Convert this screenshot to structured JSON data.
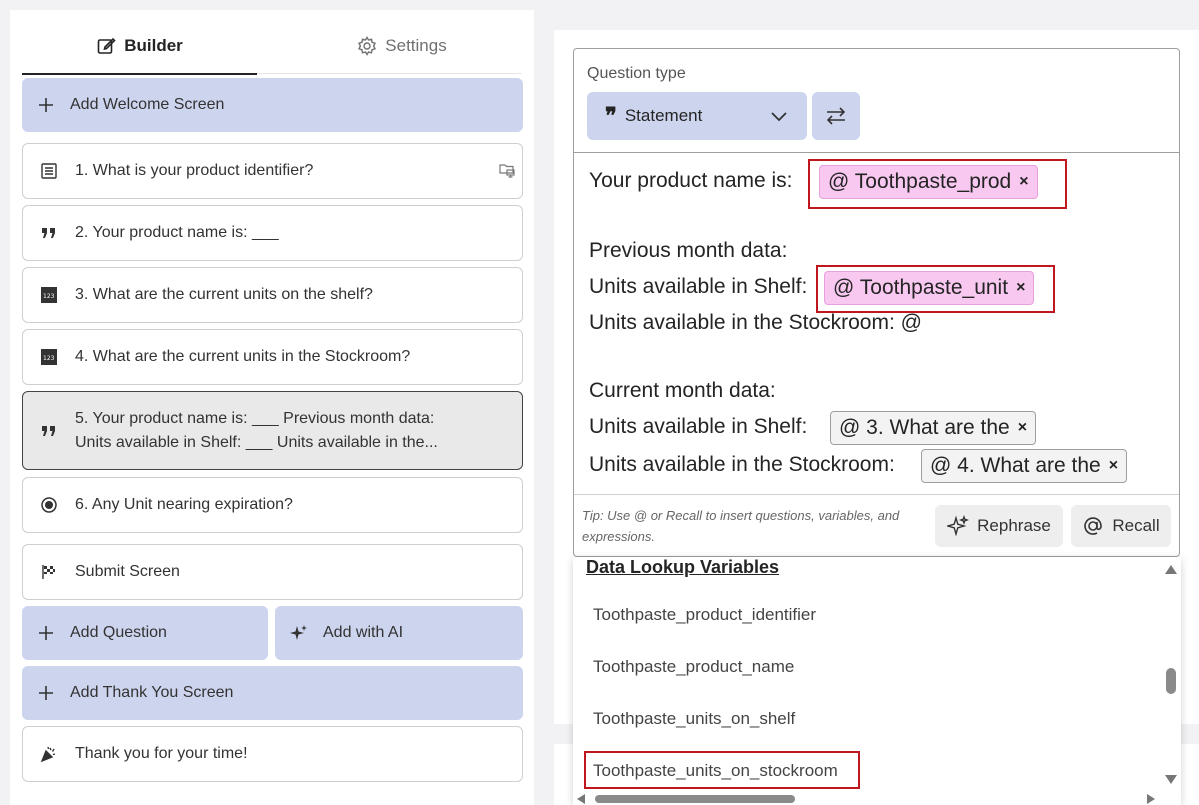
{
  "tabs": {
    "builder": "Builder",
    "settings": "Settings"
  },
  "sidebar": {
    "add_welcome": "Add Welcome Screen",
    "items": [
      {
        "label": "1. What is your product identifier?"
      },
      {
        "label": "2. Your product name is: ___"
      },
      {
        "label": "3. What are the current units on the shelf?"
      },
      {
        "label": "4. What are the current units in the Stockroom?"
      },
      {
        "label_line1": "5. Your product name is:  ___   Previous month data:",
        "label_line2": "Units available in Shelf: ___   Units available in the..."
      },
      {
        "label": "6. Any Unit nearing expiration?"
      }
    ],
    "submit": "Submit Screen",
    "add_question": "Add Question",
    "add_ai": "Add with AI",
    "add_thank_you": "Add Thank You Screen",
    "thank_you": "Thank you for your time!"
  },
  "editor": {
    "question_type_label": "Question type",
    "question_type_value": "Statement",
    "lines": {
      "l1": "Your product name is:",
      "l2": "Previous month data:",
      "l3": "Units available in Shelf:",
      "l4": "Units available in the Stockroom:  @",
      "l5": "Current month data:",
      "l6": "Units available in Shelf:",
      "l7": "Units available in the Stockroom:"
    },
    "tags": {
      "t1": "@ Toothpaste_prod",
      "t2": "@ Toothpaste_unit",
      "t3": "@ 3. What are the",
      "t4": "@ 4. What are the"
    },
    "tip": "Tip: Use @ or Recall to insert questions, variables, and expressions.",
    "rephrase": "Rephrase",
    "recall": "Recall"
  },
  "dropdown": {
    "title": "Data Lookup Variables",
    "items": [
      "Toothpaste_product_identifier",
      "Toothpaste_product_name",
      "Toothpaste_units_on_shelf",
      "Toothpaste_units_on_stockroom"
    ]
  },
  "colors": {
    "accent_blue": "#cdd4ee",
    "tag_pink": "#f9c8f0",
    "highlight_red": "#c0161d"
  }
}
